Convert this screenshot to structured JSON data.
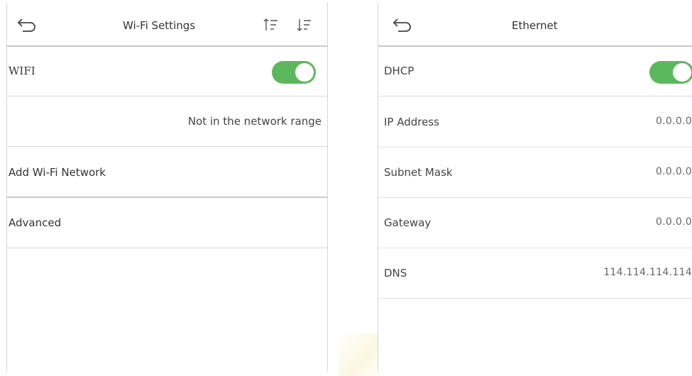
{
  "colors": {
    "accent_green": "#5cb85c",
    "divider": "#d8d8d8",
    "text": "#333333"
  },
  "wifi_screen": {
    "title": "Wi-Fi Settings",
    "back_icon": "back-arrow-icon",
    "sort_icons": [
      "sort-ascending-icon",
      "sort-descending-icon"
    ],
    "rows": {
      "wifi": {
        "label": "WIFI",
        "toggle_on": true
      },
      "status": {
        "value": "Not in the network range"
      },
      "add_network": {
        "label": "Add Wi-Fi Network"
      },
      "advanced": {
        "label": "Advanced"
      }
    }
  },
  "ethernet_screen": {
    "title": "Ethernet",
    "back_icon": "back-arrow-icon",
    "rows": {
      "dhcp": {
        "label": "DHCP",
        "toggle_on": true
      },
      "ip_address": {
        "label": "IP Address",
        "value": "0.0.0.0"
      },
      "subnet_mask": {
        "label": "Subnet Mask",
        "value": "0.0.0.0"
      },
      "gateway": {
        "label": "Gateway",
        "value": "0.0.0.0"
      },
      "dns": {
        "label": "DNS",
        "value": "114.114.114.114"
      }
    }
  }
}
